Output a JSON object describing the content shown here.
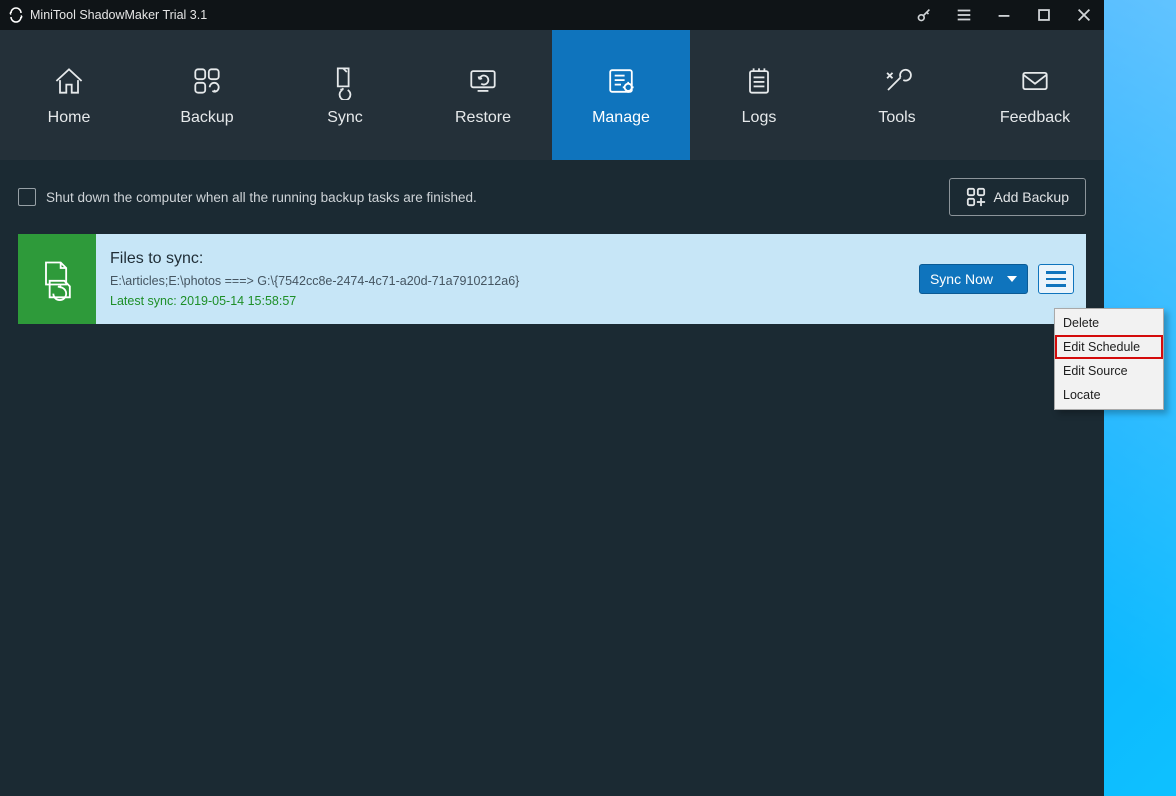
{
  "window": {
    "title": "MiniTool ShadowMaker Trial 3.1"
  },
  "nav": {
    "items": [
      {
        "label": "Home"
      },
      {
        "label": "Backup"
      },
      {
        "label": "Sync"
      },
      {
        "label": "Restore"
      },
      {
        "label": "Manage"
      },
      {
        "label": "Logs"
      },
      {
        "label": "Tools"
      },
      {
        "label": "Feedback"
      }
    ]
  },
  "topbar": {
    "shutdown_checkbox_label": "Shut down the computer when all the running backup tasks are finished.",
    "add_backup_label": "Add Backup"
  },
  "task": {
    "title": "Files to sync:",
    "path": "E:\\articles;E:\\photos ===> G:\\{7542cc8e-2474-4c71-a20d-71a7910212a6}",
    "latest": "Latest sync: 2019-05-14 15:58:57",
    "sync_now_label": "Sync Now"
  },
  "context_menu": {
    "items": [
      {
        "label": "Delete"
      },
      {
        "label": "Edit Schedule",
        "highlight": true
      },
      {
        "label": "Edit Source"
      },
      {
        "label": "Locate"
      }
    ]
  }
}
